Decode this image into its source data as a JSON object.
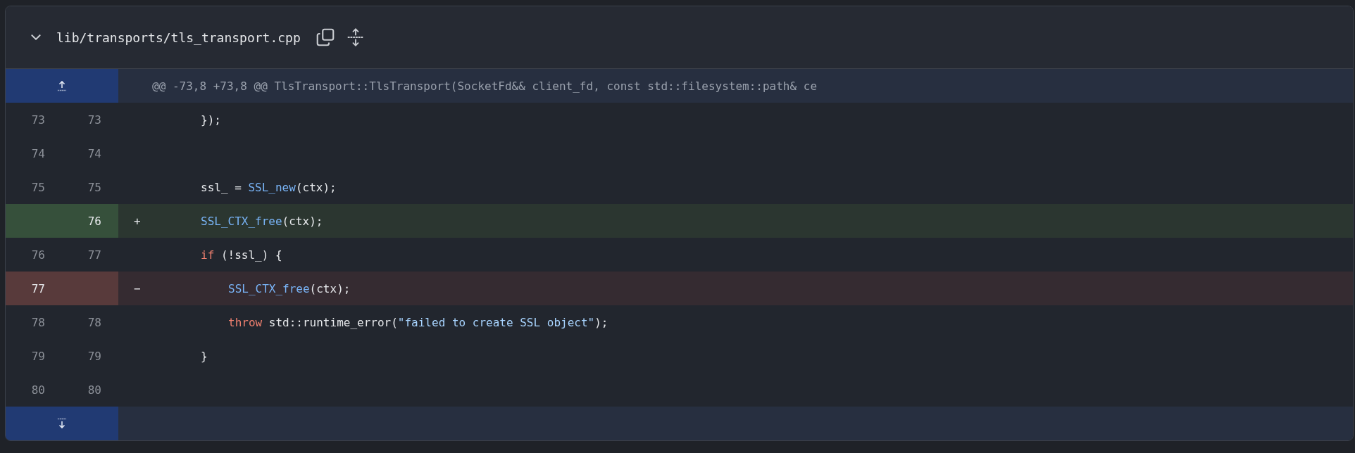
{
  "file": {
    "path": "lib/transports/tls_transport.cpp",
    "expanded": true
  },
  "hunk": {
    "header": "@@ -73,8 +73,8 @@ TlsTransport::TlsTransport(SocketFd&& client_fd, const std::filesystem::path& ce"
  },
  "lines": [
    {
      "kind": "context",
      "old": "73",
      "new": "73",
      "nested": false,
      "tokens": [
        {
          "kind": "plain",
          "text": "});"
        }
      ]
    },
    {
      "kind": "context",
      "old": "74",
      "new": "74"
    },
    {
      "kind": "context",
      "old": "75",
      "new": "75",
      "nested": false,
      "tokens": [
        {
          "kind": "plain",
          "text": "ssl_ = "
        },
        {
          "kind": "function",
          "text": "SSL_new"
        },
        {
          "kind": "plain",
          "text": "(ctx);"
        }
      ]
    },
    {
      "kind": "added",
      "new": "76",
      "sign": "+",
      "nested": false,
      "tokens": [
        {
          "kind": "function",
          "text": "SSL_CTX_free"
        },
        {
          "kind": "plain",
          "text": "(ctx);"
        }
      ]
    },
    {
      "kind": "context",
      "old": "76",
      "new": "77",
      "nested": false,
      "tokens": [
        {
          "kind": "keyword",
          "text": "if"
        },
        {
          "kind": "plain",
          "text": " (!ssl_) {"
        }
      ]
    },
    {
      "kind": "deleted",
      "old": "77",
      "sign": "−",
      "nested": true,
      "tokens": [
        {
          "kind": "function",
          "text": "SSL_CTX_free"
        },
        {
          "kind": "plain",
          "text": "(ctx);"
        }
      ]
    },
    {
      "kind": "context",
      "old": "78",
      "new": "78",
      "nested": true,
      "tokens": [
        {
          "kind": "keyword",
          "text": "throw"
        },
        {
          "kind": "plain",
          "text": " std::runtime_error("
        },
        {
          "kind": "string",
          "text": "\"failed to create SSL object\""
        },
        {
          "kind": "plain",
          "text": ");"
        }
      ]
    },
    {
      "kind": "context",
      "old": "79",
      "new": "79",
      "nested": false,
      "tokens": [
        {
          "kind": "plain",
          "text": "}"
        }
      ]
    },
    {
      "kind": "context",
      "old": "80",
      "new": "80"
    }
  ]
}
